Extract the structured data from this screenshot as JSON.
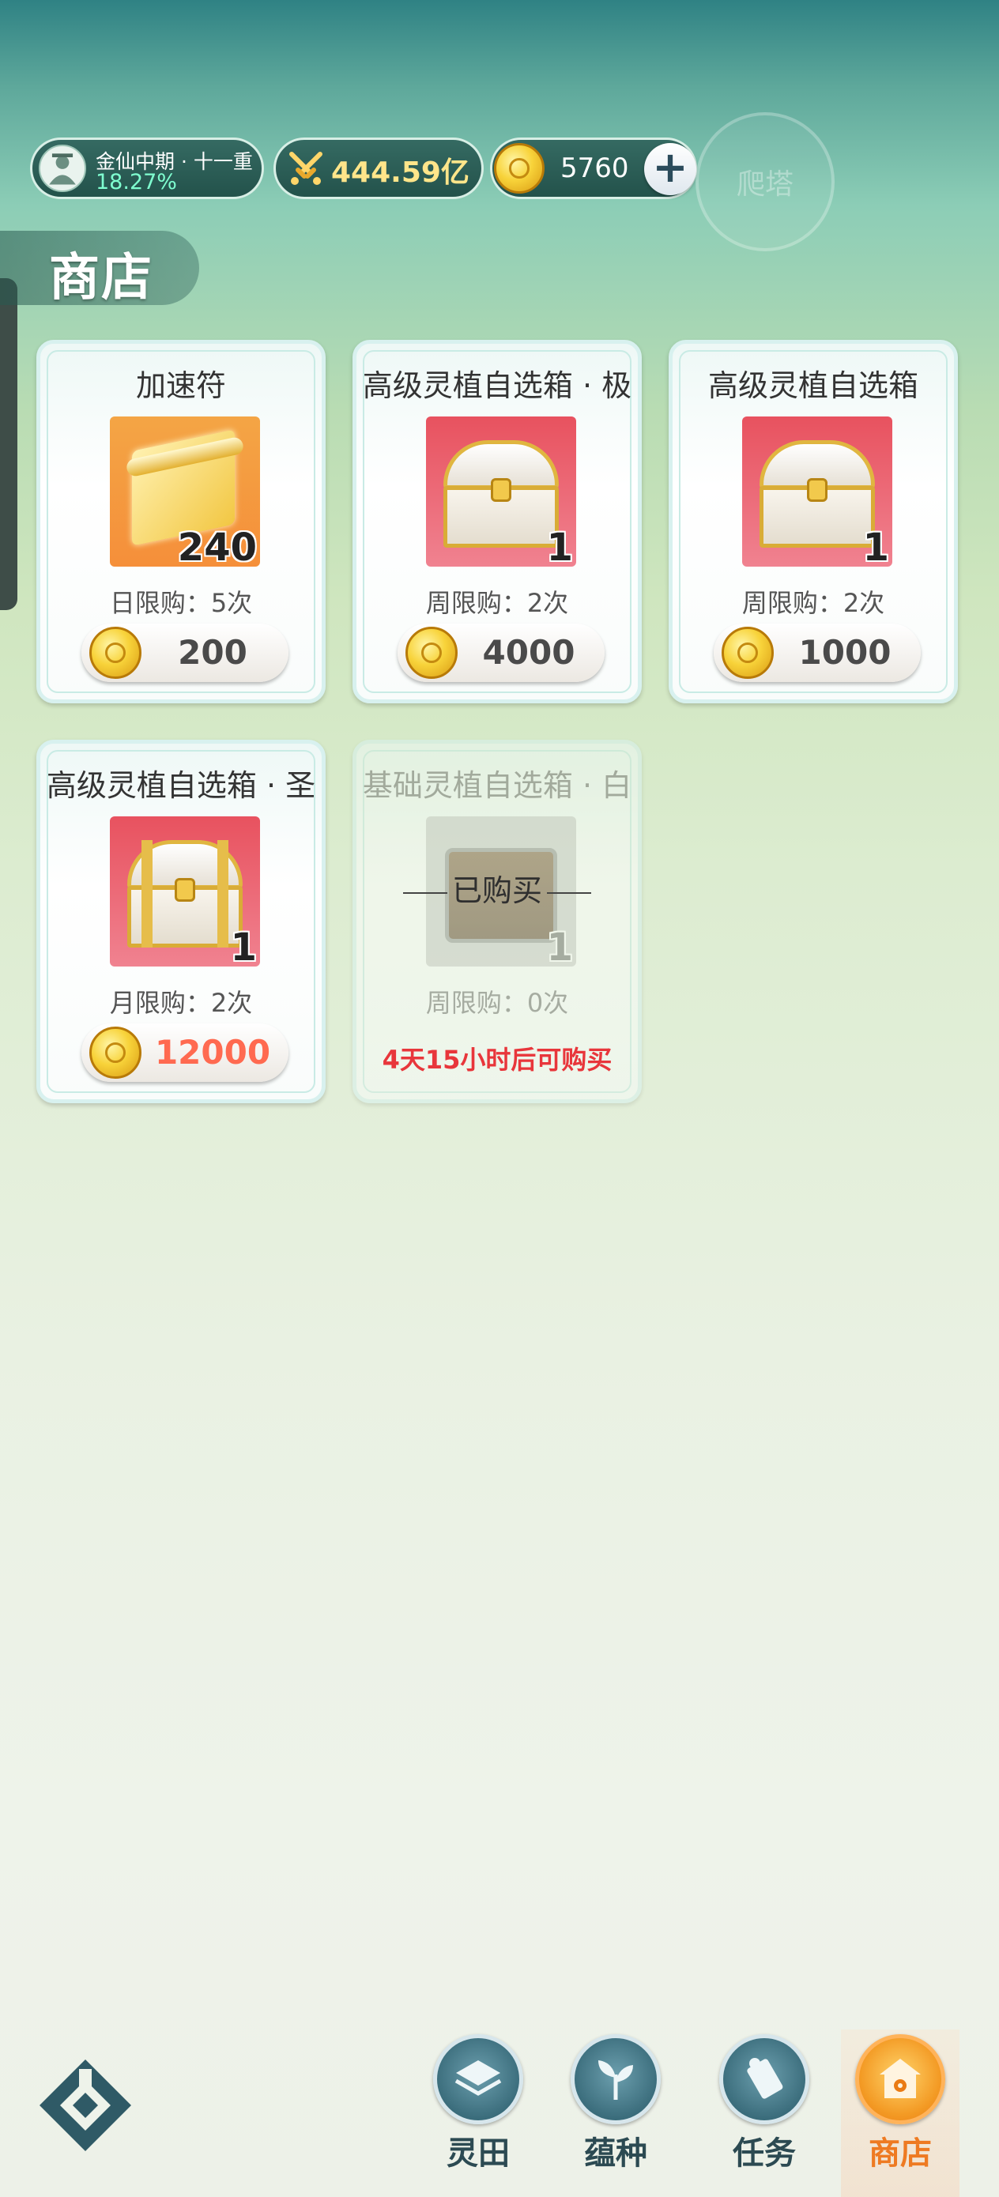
{
  "header": {
    "realm": "金仙中期 · 十一重",
    "realm_progress": "18.27%",
    "power": "444.59亿",
    "coins": "5760",
    "add_icon": "plus-icon",
    "tower_button": "爬塔"
  },
  "shop": {
    "title": "商店",
    "items": [
      {
        "name": "加速符",
        "quantity": "240",
        "limit": "日限购：5次",
        "price": "200",
        "icon": "scroll-icon"
      },
      {
        "name": "高级灵植自选箱 · 极",
        "quantity": "1",
        "limit": "周限购：2次",
        "price": "4000",
        "icon": "chest-icon"
      },
      {
        "name": "高级灵植自选箱",
        "quantity": "1",
        "limit": "周限购：2次",
        "price": "1000",
        "icon": "chest-icon"
      },
      {
        "name": "高级灵植自选箱 · 圣",
        "quantity": "1",
        "limit": "月限购：2次",
        "price": "12000",
        "price_color": "#ff6a50",
        "icon": "chest-icon"
      },
      {
        "name": "基础灵植自选箱 · 白",
        "quantity": "1",
        "limit": "周限购：0次",
        "status": "已购买",
        "restock": "4天15小时后可购买",
        "icon": "wood-chest-icon"
      }
    ]
  },
  "nav": {
    "home_icon": "home-logo-icon",
    "items": [
      {
        "label": "灵田",
        "icon": "field-icon"
      },
      {
        "label": "蕴种",
        "icon": "sprout-icon"
      },
      {
        "label": "任务",
        "icon": "scroll-task-icon"
      },
      {
        "label": "商店",
        "icon": "shop-icon",
        "active": true
      }
    ]
  },
  "colors": {
    "accent_active": "#ee7a22",
    "restock_text": "#e8363b",
    "power_text": "#ffe58a",
    "progress_text": "#7fffd0"
  }
}
